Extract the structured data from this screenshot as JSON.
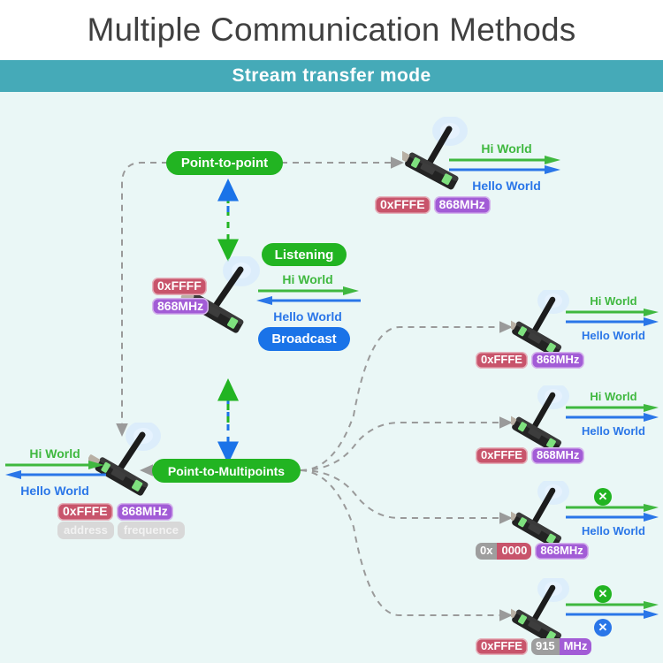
{
  "header": {
    "title": "Multiple Communication Methods",
    "subtitle": "Stream transfer mode"
  },
  "colors": {
    "header_band": "#45aab8",
    "canvas_bg": "#eaf7f6",
    "pill_green": "#22b422",
    "pill_blue": "#1a73e8",
    "badge_address": "#c8546b",
    "badge_frequency": "#a25cd6",
    "badge_disabled": "#9e9e9e",
    "arrow_hi": "#3fb83f",
    "arrow_hello": "#2a76e8",
    "wire_dashed": "#9a9a9a",
    "title_text": "#404040"
  },
  "labels": {
    "point_to_point": "Point-to-point",
    "point_to_multipoints": "Point-to-Multipoints",
    "listening": "Listening",
    "broadcast": "Broadcast",
    "hi_world": "Hi World",
    "hello_world": "Hello World",
    "caption_address": "address",
    "caption_frequence": "frequence",
    "blocked_mark": "✕"
  },
  "nodes": {
    "top_right": {
      "name": "point-to-point-peer",
      "address": "0xFFFE",
      "frequency": "868MHz",
      "hi_world": "Hi World",
      "hello_world": "Hello World",
      "hi_blocked": false,
      "hello_blocked": false
    },
    "center": {
      "name": "host-dongle",
      "address": "0xFFFF",
      "frequency": "868MHz",
      "hi_world": "Hi World",
      "hello_world": "Hello World",
      "mode_rx": "Listening",
      "mode_tx": "Broadcast"
    },
    "bottom_left": {
      "name": "multipoint-source",
      "address": "0xFFFE",
      "frequency": "868MHz",
      "caption_address": "address",
      "caption_frequence": "frequence",
      "hi_world": "Hi World",
      "hello_world": "Hello World"
    },
    "fanout": [
      {
        "name": "peer-1",
        "address": "0xFFFE",
        "frequency": "868MHz",
        "address_prefix": "",
        "frequency_prefix": "",
        "hi_world": "Hi World",
        "hello_world": "Hello World",
        "hi_blocked": false,
        "hello_blocked": false
      },
      {
        "name": "peer-2",
        "address": "0xFFFE",
        "frequency": "868MHz",
        "address_prefix": "",
        "frequency_prefix": "",
        "hi_world": "Hi World",
        "hello_world": "Hello World",
        "hi_blocked": false,
        "hello_blocked": false
      },
      {
        "name": "peer-3",
        "address_prefix": "0x",
        "address": "0000",
        "frequency_prefix": "",
        "frequency": "868MHz",
        "hi_world": "",
        "hello_world": "Hello World",
        "hi_blocked": true,
        "hello_blocked": false
      },
      {
        "name": "peer-4",
        "address_prefix": "",
        "address": "0xFFFE",
        "frequency_prefix": "915",
        "frequency": "MHz",
        "hi_world": "",
        "hello_world": "",
        "hi_blocked": true,
        "hello_blocked": true
      }
    ]
  }
}
